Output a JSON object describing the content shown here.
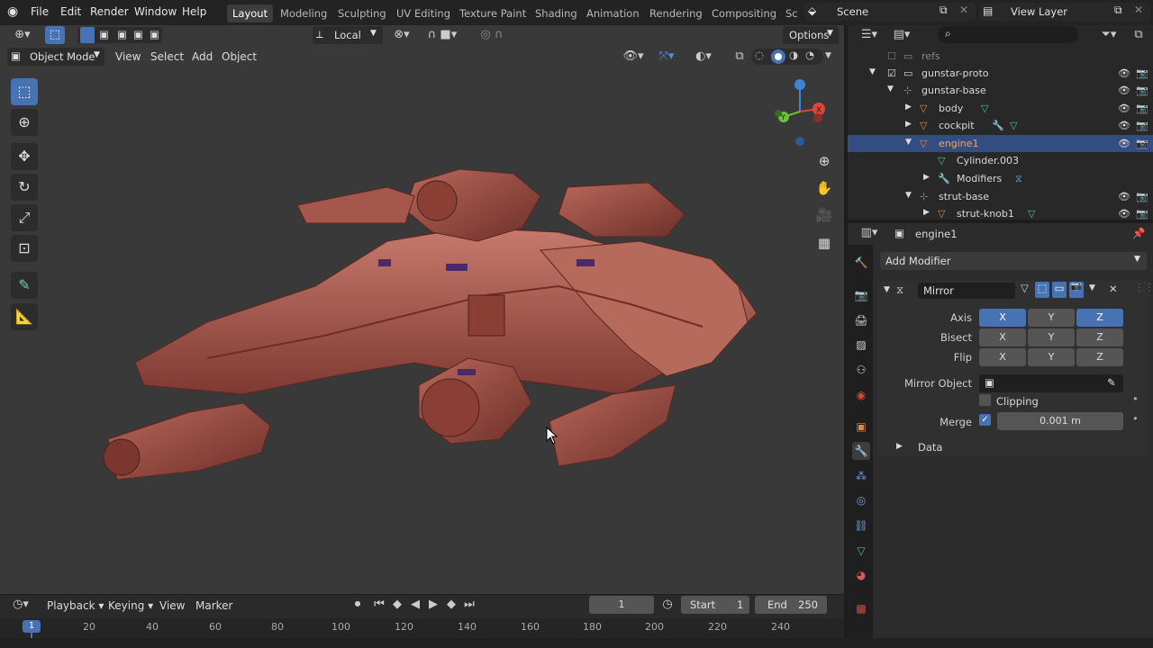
{
  "menubar": {
    "items": [
      "File",
      "Edit",
      "Render",
      "Window",
      "Help"
    ],
    "workspaces": [
      "Layout",
      "Modeling",
      "Sculpting",
      "UV Editing",
      "Texture Paint",
      "Shading",
      "Animation",
      "Rendering",
      "Compositing",
      "Sc"
    ],
    "active_workspace": "Layout",
    "scene": "Scene",
    "view_layer": "View Layer"
  },
  "viewport": {
    "orientation": "Local",
    "options_label": "Options",
    "mode": "Object Mode",
    "menu": [
      "View",
      "Select",
      "Add",
      "Object"
    ]
  },
  "gizmo": {
    "x_label": "X",
    "y_label": "Y"
  },
  "outliner": {
    "search_placeholder": "",
    "rows": [
      {
        "label": "refs"
      },
      {
        "label": "gunstar-proto"
      },
      {
        "label": "gunstar-base"
      },
      {
        "label": "body"
      },
      {
        "label": "cockpit"
      },
      {
        "label": "engine1"
      },
      {
        "label": "Cylinder.003"
      },
      {
        "label": "Modifiers"
      },
      {
        "label": "strut-base"
      },
      {
        "label": "strut-knob1"
      }
    ]
  },
  "properties": {
    "object_name": "engine1",
    "add_modifier": "Add Modifier",
    "modifier_name": "Mirror",
    "axis_label": "Axis",
    "bisect_label": "Bisect",
    "flip_label": "Flip",
    "x": "X",
    "y": "Y",
    "z": "Z",
    "mirror_object_label": "Mirror Object",
    "clipping_label": "Clipping",
    "merge_label": "Merge",
    "merge_value": "0.001 m",
    "data_label": "Data"
  },
  "timeline": {
    "menu": [
      "Playback",
      "Keying",
      "View",
      "Marker"
    ],
    "current_frame": "1",
    "start_label": "Start",
    "start_value": "1",
    "end_label": "End",
    "end_value": "250",
    "ruler": [
      "1",
      "20",
      "40",
      "60",
      "80",
      "100",
      "120",
      "140",
      "160",
      "180",
      "200",
      "220",
      "240"
    ]
  },
  "colors": {
    "accent": "#4772b3",
    "selection": "#334d80",
    "model": "#9b4f45",
    "axis_x": "#e0453d",
    "axis_y": "#6fbf3a",
    "axis_z": "#3f82d8",
    "mesh_icon": "#e8873a",
    "data_icon": "#4cc38a"
  }
}
